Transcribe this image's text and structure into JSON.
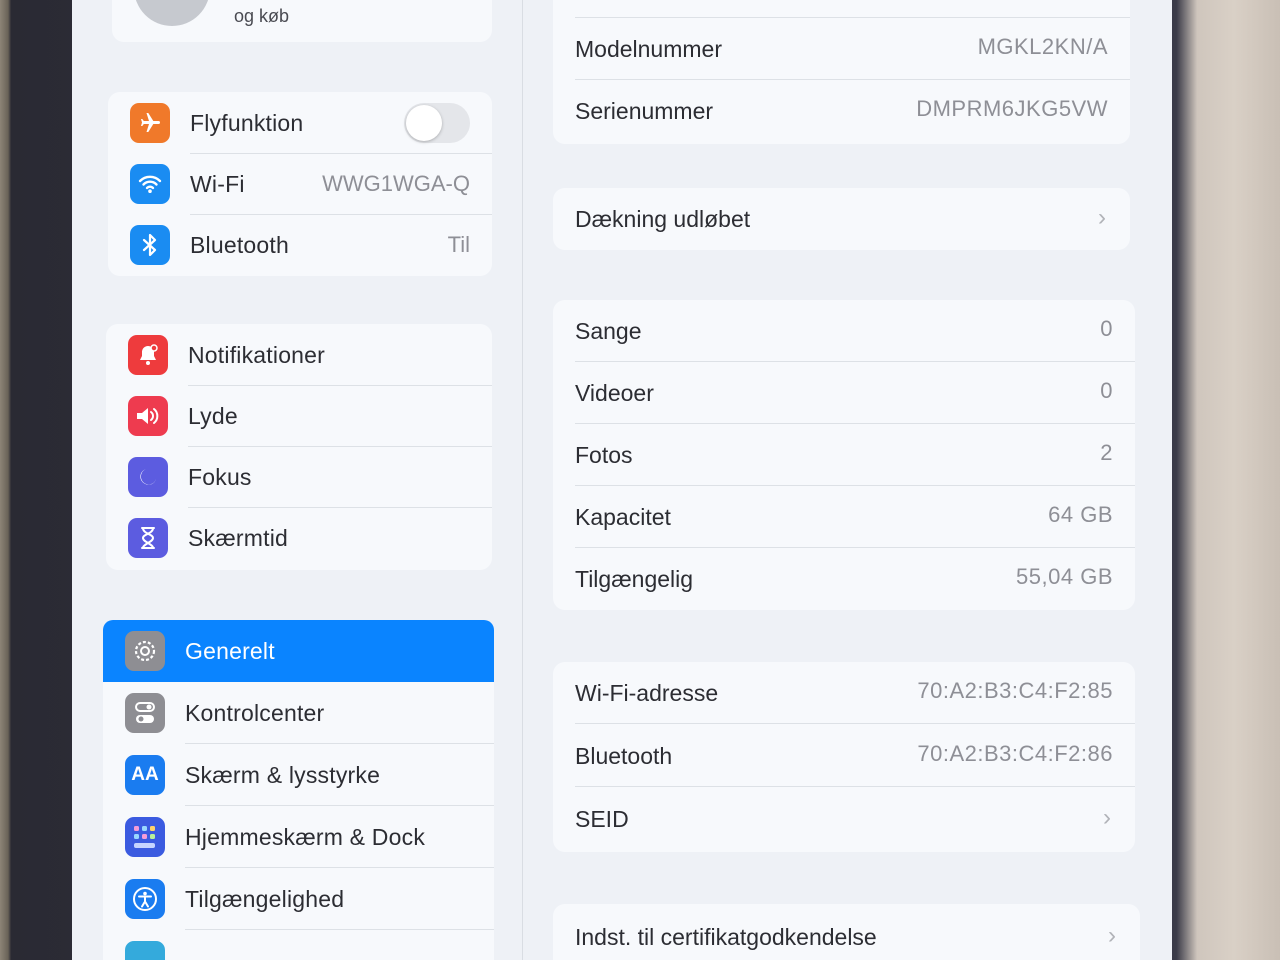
{
  "account": {
    "subtitle": "og køb"
  },
  "sidebar": {
    "connectivity": [
      {
        "label": "Flyfunktion",
        "icon": "airplane-icon",
        "color": "#f0792a",
        "toggle": "off"
      },
      {
        "label": "Wi-Fi",
        "value": "WWG1WGA-Q",
        "icon": "wifi-icon",
        "color": "#1a8cf2"
      },
      {
        "label": "Bluetooth",
        "value": "Til",
        "icon": "bluetooth-icon",
        "color": "#1a8cf2"
      }
    ],
    "notifications": [
      {
        "label": "Notifikationer",
        "icon": "notifications-icon",
        "color": "#ee3b3d"
      },
      {
        "label": "Lyde",
        "icon": "sound-icon",
        "color": "#ee3b4f"
      },
      {
        "label": "Fokus",
        "icon": "moon-icon",
        "color": "#5c5ce0"
      },
      {
        "label": "Skærmtid",
        "icon": "hourglass-icon",
        "color": "#5c5ce0"
      }
    ],
    "general": [
      {
        "label": "Generelt",
        "icon": "gear-icon",
        "color": "#8e8e93",
        "active": true
      },
      {
        "label": "Kontrolcenter",
        "icon": "switches-icon",
        "color": "#8e8e93"
      },
      {
        "label": "Skærm & lysstyrke",
        "icon": "display-icon",
        "color": "#1a7cf0",
        "glyph": "AA"
      },
      {
        "label": "Hjemmeskærm & Dock",
        "icon": "home-grid-icon",
        "color": "#3b5be0"
      },
      {
        "label": "Tilgængelighed",
        "icon": "accessibility-icon",
        "color": "#1a7cf0"
      }
    ]
  },
  "detail": {
    "ident": [
      {
        "label": "Modelnummer",
        "value": "MGKL2KN/A"
      },
      {
        "label": "Serienummer",
        "value": "DMPRM6JKG5VW"
      }
    ],
    "coverage": {
      "label": "Dækning udløbet"
    },
    "media": [
      {
        "label": "Sange",
        "value": "0"
      },
      {
        "label": "Videoer",
        "value": "0"
      },
      {
        "label": "Fotos",
        "value": "2"
      },
      {
        "label": "Kapacitet",
        "value": "64 GB"
      },
      {
        "label": "Tilgængelig",
        "value": "55,04 GB"
      }
    ],
    "network": [
      {
        "label": "Wi-Fi-adresse",
        "value": "70:A2:B3:C4:F2:85"
      },
      {
        "label": "Bluetooth",
        "value": "70:A2:B3:C4:F2:86"
      },
      {
        "label": "SEID"
      }
    ],
    "certificate": {
      "label": "Indst. til certifikatgodkendelse"
    }
  }
}
